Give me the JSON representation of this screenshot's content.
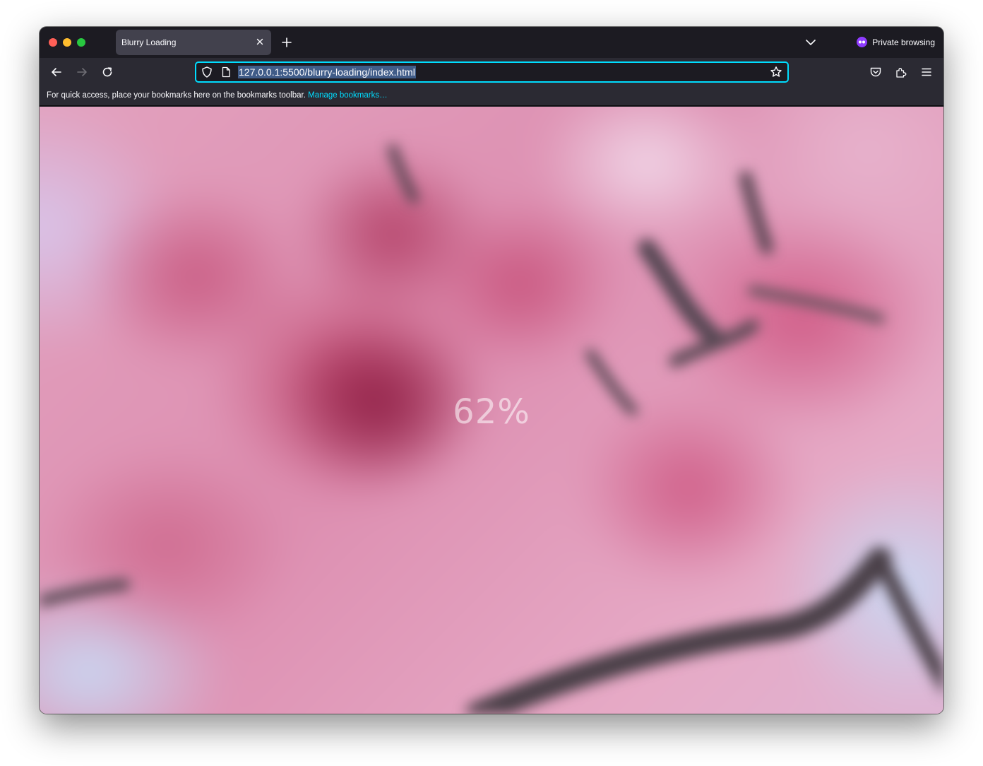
{
  "browser": {
    "tab": {
      "title": "Blurry Loading"
    },
    "private_label": "Private browsing",
    "url": "127.0.0.1:5500/blurry-loading/index.html",
    "bookmarks_bar": {
      "message": "For quick access, place your bookmarks here on the bookmarks toolbar.",
      "manage_link": "Manage bookmarks…"
    },
    "icons": {
      "close_tab": "close-icon",
      "new_tab": "plus-icon",
      "tab_list": "chevron-down-icon",
      "private": "private-mask-icon",
      "back": "back-arrow-icon",
      "forward": "forward-arrow-icon",
      "reload": "reload-icon",
      "tracking": "shield-icon",
      "page": "page-icon",
      "bookmark": "star-icon",
      "pocket": "pocket-icon",
      "extensions": "puzzle-icon",
      "menu": "hamburger-icon"
    },
    "colors": {
      "chrome_dark": "#1c1b22",
      "toolbar": "#2b2a33",
      "accent": "#00ddff",
      "private_purple": "#8f3cff"
    }
  },
  "page": {
    "loading_percent_text": "62%",
    "loading_value": 62,
    "background": "blurred pink cherry blossoms"
  }
}
